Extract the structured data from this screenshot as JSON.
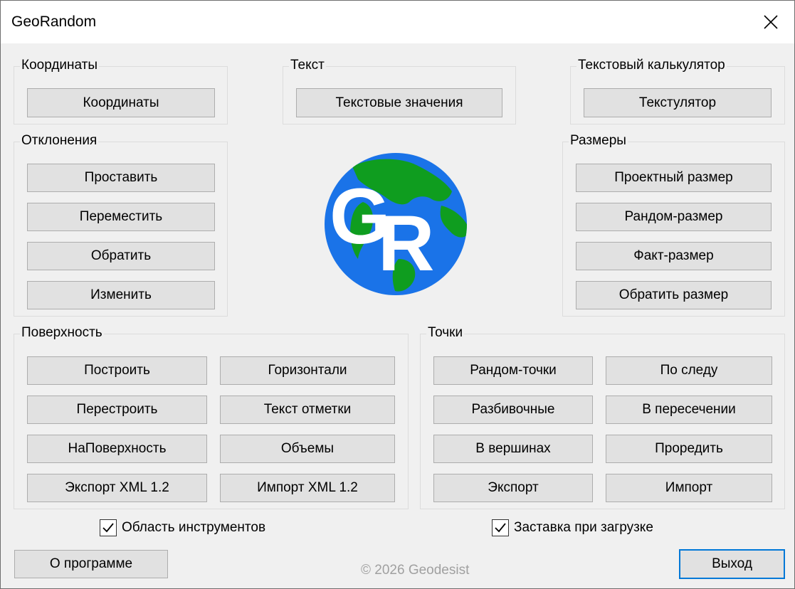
{
  "window": {
    "title": "GeoRandom"
  },
  "groups": {
    "coords": {
      "label": "Координаты",
      "buttons": [
        "Координаты"
      ]
    },
    "text": {
      "label": "Текст",
      "buttons": [
        "Текстовые значения"
      ]
    },
    "calc": {
      "label": "Текстовый калькулятор",
      "buttons": [
        "Текстулятор"
      ]
    },
    "deviations": {
      "label": "Отклонения",
      "buttons": [
        "Проставить",
        "Переместить",
        "Обратить",
        "Изменить"
      ]
    },
    "sizes": {
      "label": "Размеры",
      "buttons": [
        "Проектный размер",
        "Рандом-размер",
        "Факт-размер",
        "Обратить размер"
      ]
    },
    "surface": {
      "label": "Поверхность",
      "buttons": [
        "Построить",
        "Горизонтали",
        "Перестроить",
        "Текст отметки",
        "НаПоверхность",
        "Объемы",
        "Экспорт XML 1.2",
        "Импорт XML 1.2"
      ]
    },
    "points": {
      "label": "Точки",
      "buttons": [
        "Рандом-точки",
        "По следу",
        "Разбивочные",
        "В пересечении",
        "В вершинах",
        "Проредить",
        "Экспорт",
        "Импорт"
      ]
    }
  },
  "logo": {
    "text_left": "G",
    "text_right": "R"
  },
  "options": {
    "tools_area": {
      "label": "Область инструментов",
      "checked": true
    },
    "splash": {
      "label": "Заставка при загрузке",
      "checked": true
    }
  },
  "footer": {
    "about": "О программе",
    "copyright": "© 2026 Geodesist",
    "exit": "Выход"
  },
  "colors": {
    "ocean": "#1a73e8",
    "land": "#0f9d1f",
    "accent": "#0078d7"
  }
}
